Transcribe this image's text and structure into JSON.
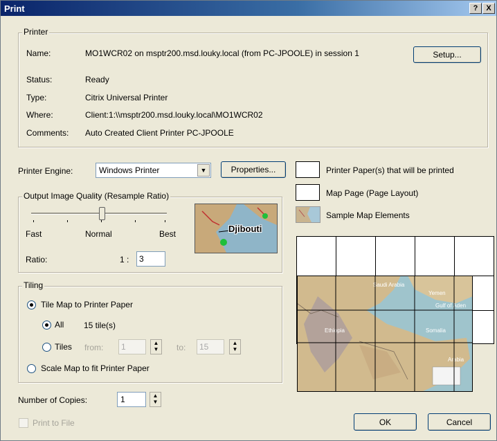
{
  "window": {
    "title": "Print",
    "help": "?",
    "close": "X"
  },
  "printer": {
    "group_label": "Printer",
    "name_label": "Name:",
    "name_value": "MO1WCR02 on msptr200.msd.louky.local (from PC-JPOOLE) in session 1",
    "status_label": "Status:",
    "status_value": "Ready",
    "type_label": "Type:",
    "type_value": "Citrix Universal Printer",
    "where_label": "Where:",
    "where_value": "Client:1:\\\\msptr200.msd.louky.local\\MO1WCR02",
    "comments_label": "Comments:",
    "comments_value": "Auto Created Client Printer PC-JPOOLE",
    "setup_button": "Setup..."
  },
  "engine": {
    "label": "Printer Engine:",
    "value": "Windows Printer",
    "properties_button": "Properties..."
  },
  "quality": {
    "group_label": "Output Image Quality (Resample Ratio)",
    "fast": "Fast",
    "normal": "Normal",
    "best": "Best",
    "ratio_label": "Ratio:",
    "ratio_prefix": "1 :",
    "ratio_value": "3",
    "slider_level": 0.5,
    "sample_place": "Djibouti"
  },
  "legend": {
    "paper": "Printer Paper(s) that will be printed",
    "page": "Map Page (Page Layout)",
    "elements": "Sample Map Elements"
  },
  "tiling": {
    "group_label": "Tiling",
    "tile_option": "Tile Map to Printer Paper",
    "all_option": "All",
    "tile_count": "15 tile(s)",
    "tiles_option": "Tiles",
    "from_label": "from:",
    "from_value": "1",
    "to_label": "to:",
    "to_value": "15",
    "scale_option": "Scale Map to fit Printer Paper"
  },
  "preview_map_labels": [
    "Saudi Arabia",
    "Yemen",
    "Gulf of Aden",
    "Somalia",
    "Ethiopia",
    "Arabia"
  ],
  "copies": {
    "label": "Number of Copies:",
    "value": "1"
  },
  "print_to_file": "Print to File",
  "ok_button": "OK",
  "cancel_button": "Cancel",
  "colors": {
    "title_start": "#0a246a",
    "title_end": "#a6caf0",
    "dialog_bg": "#ece9d8"
  }
}
